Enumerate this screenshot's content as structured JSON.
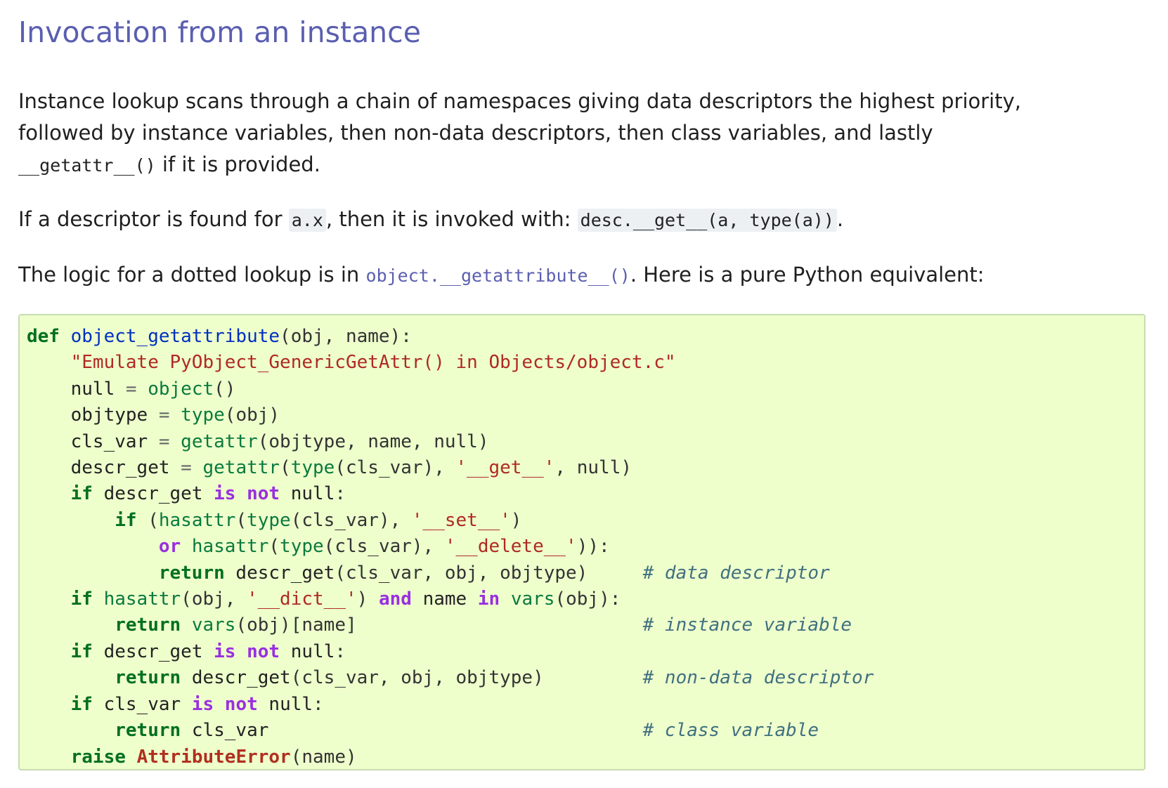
{
  "section": {
    "title": "Invocation from an instance"
  },
  "para1": {
    "line1": "Instance lookup scans through a chain of namespaces giving data descriptors the highest priority,",
    "line2": "followed by instance variables, then non-data descriptors, then class variables, and lastly",
    "code": "__getattr__()",
    "tail": " if it is provided."
  },
  "para2": {
    "text_a": "If a descriptor is found for ",
    "code_a": "a.x",
    "text_b": ", then it is invoked with: ",
    "code_b": "desc.__get__(a, type(a))",
    "text_c": "."
  },
  "para3": {
    "text_a": "The logic for a dotted lookup is in ",
    "link": "object.__getattribute__()",
    "text_b": ". Here is a pure Python equivalent:"
  },
  "code_block": {
    "comments": {
      "c1": "# data descriptor",
      "c2": "# instance variable",
      "c3": "# non-data descriptor",
      "c4": "# class variable"
    },
    "docstring": "\"Emulate PyObject_GenericGetAttr() in Objects/object.c\""
  }
}
